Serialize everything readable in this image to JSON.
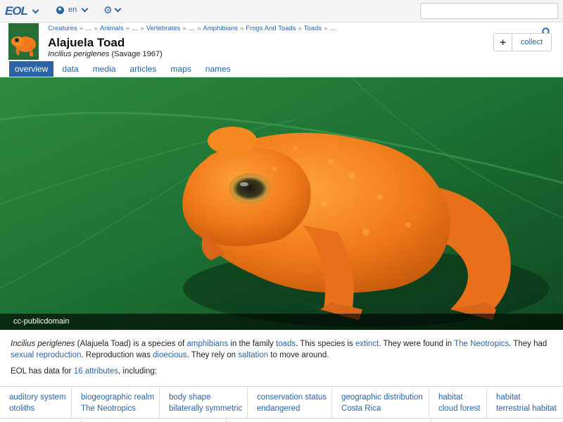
{
  "topbar": {
    "logo": "EOL",
    "language": "en",
    "search_placeholder": ""
  },
  "header": {
    "breadcrumb": [
      "Creatures",
      "…",
      "Animals",
      "…",
      "Vertebrates",
      "…",
      "Amphibians",
      "Frogs And Toads",
      "Toads",
      "…"
    ],
    "title": "Alajuela Toad",
    "scientific_name": "Incilius periglenes",
    "authority": "(Savage 1967)",
    "collect_label": "collect",
    "collect_plus": "+"
  },
  "tabs": [
    "overview",
    "data",
    "media",
    "articles",
    "maps",
    "names"
  ],
  "active_tab": "overview",
  "hero": {
    "caption": "cc-publicdomain"
  },
  "description": {
    "name_italic": "Incilius periglenes",
    "part1": " (Alajuela Toad) is a species of ",
    "link_amphibians": "amphibians",
    "part2": " in the family ",
    "link_toads": "toads",
    "part3": ". This species is ",
    "link_extinct": "extinct",
    "part4": ". They were found in ",
    "link_neotropics": "The Neotropics",
    "part5": ". They had ",
    "link_sexual": "sexual reproduction",
    "part6": ". Reproduction was ",
    "link_dioecious": "dioecious",
    "part7": ". They rely on ",
    "link_saltation": "saltation",
    "part8": " to move around."
  },
  "attributes": {
    "prefix": "EOL has data for ",
    "link": "16 attributes",
    "suffix": ", including:",
    "cells": [
      {
        "key": "auditory system",
        "value": "otoliths"
      },
      {
        "key": "biogeographic realm",
        "value": "The Neotropics"
      },
      {
        "key": "body shape",
        "value": "bilaterally symmetric"
      },
      {
        "key": "conservation status",
        "value": "endangered"
      },
      {
        "key": "geographic distribution",
        "value": "Costa Rica"
      },
      {
        "key": "habitat",
        "value": "cloud forest"
      },
      {
        "key": "habitat",
        "value": "terrestrial habitat"
      }
    ]
  },
  "colors": {
    "accent": "#2a64a6",
    "toad_orange": "#f07a1a",
    "leaf_green": "#1f7a3a"
  }
}
